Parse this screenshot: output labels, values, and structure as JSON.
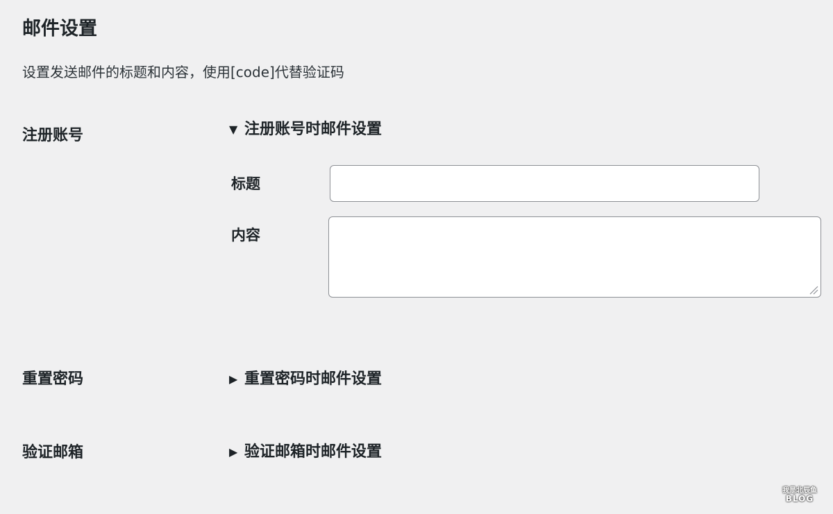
{
  "header": {
    "title": "邮件设置",
    "description": "设置发送邮件的标题和内容，使用[code]代替验证码"
  },
  "sections": [
    {
      "label": "注册账号",
      "summary": "注册账号时邮件设置",
      "expanded": true,
      "fields": {
        "title_label": "标题",
        "title_value": "",
        "content_label": "内容",
        "content_value": ""
      }
    },
    {
      "label": "重置密码",
      "summary": "重置密码时邮件设置",
      "expanded": false
    },
    {
      "label": "验证邮箱",
      "summary": "验证邮箱时邮件设置",
      "expanded": false
    }
  ],
  "icons": {
    "expanded": "triangle-down-icon",
    "collapsed": "triangle-right-icon"
  },
  "watermark": {
    "top": "我是北辰鱼",
    "bottom": "BLOG"
  }
}
